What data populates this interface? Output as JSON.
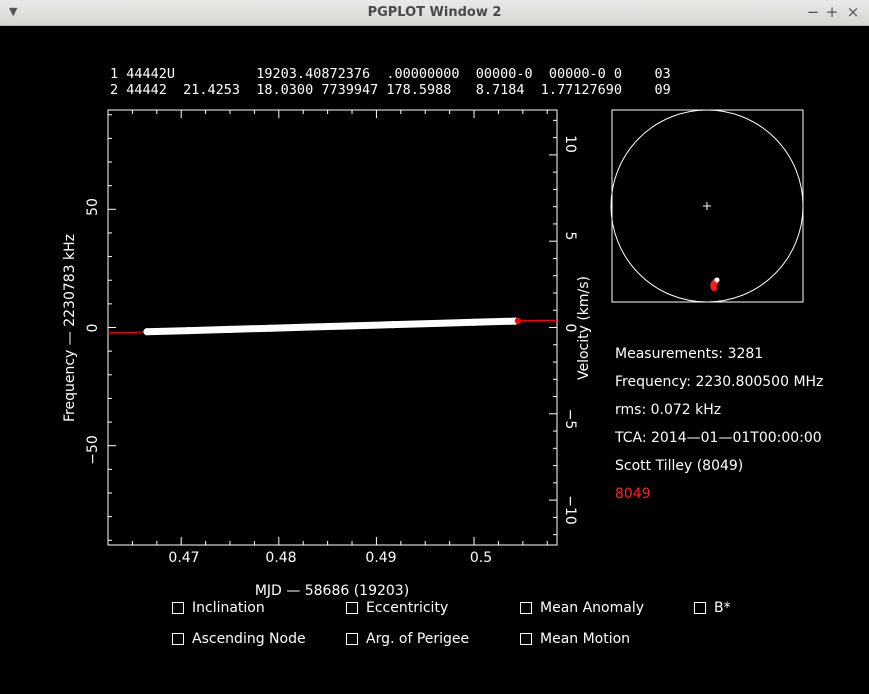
{
  "window": {
    "title": "PGPLOT Window 2"
  },
  "tle": {
    "line1": "1 44442U          19203.40872376  .00000000  00000-0  00000-0 0    03",
    "line2": "2 44442  21.4253  18.0300 7739947 178.5988   8.7184  1.77127690    09"
  },
  "plot": {
    "xlabel": "MJD — 58686 (19203)",
    "ylabel_left": "Frequency — 2230783 kHz",
    "ylabel_right": "Velocity (km/s)",
    "x_ticks": [
      "0.47",
      "0.48",
      "0.49",
      "0.5"
    ],
    "y_left_ticks": [
      "50",
      "0",
      "−50"
    ],
    "y_right_ticks": [
      "10",
      "5",
      "0",
      "−5",
      "−10"
    ]
  },
  "chart_data": {
    "type": "scatter",
    "x_range": [
      0.4625,
      0.5085
    ],
    "y_range": [
      -92,
      92
    ],
    "y2_range": [
      -12.6,
      12.6
    ],
    "series": [
      {
        "color": "#ffffff",
        "x": [
          0.4665,
          0.4708,
          0.475,
          0.4792,
          0.4833,
          0.4875,
          0.4917,
          0.4958,
          0.5,
          0.5042
        ],
        "y": [
          -1.8,
          -1.3,
          -0.8,
          -0.3,
          0.2,
          0.7,
          1.2,
          1.7,
          2.2,
          2.7
        ]
      },
      {
        "color": "#ff0000",
        "x": [
          0.4625,
          0.4645,
          0.4665,
          0.5045,
          0.5065,
          0.5085
        ],
        "y": [
          -2.2,
          -2.2,
          -1.8,
          2.8,
          3.0,
          3.0
        ]
      }
    ]
  },
  "info": {
    "measurements": "Measurements: 3281",
    "frequency": "Frequency: 2230.800500 MHz",
    "rms": "rms: 0.072 kHz",
    "tca": "TCA: 2014—01—01T00:00:00",
    "observer": "Scott Tilley (8049)",
    "site": "8049",
    "site_color": "#ff2020"
  },
  "checkboxes": {
    "inclination": "Inclination",
    "eccentricity": "Eccentricity",
    "mean_anomaly": "Mean Anomaly",
    "bstar": "B*",
    "ascending_node": "Ascending Node",
    "arg_perigee": "Arg. of Perigee",
    "mean_motion": "Mean Motion"
  }
}
